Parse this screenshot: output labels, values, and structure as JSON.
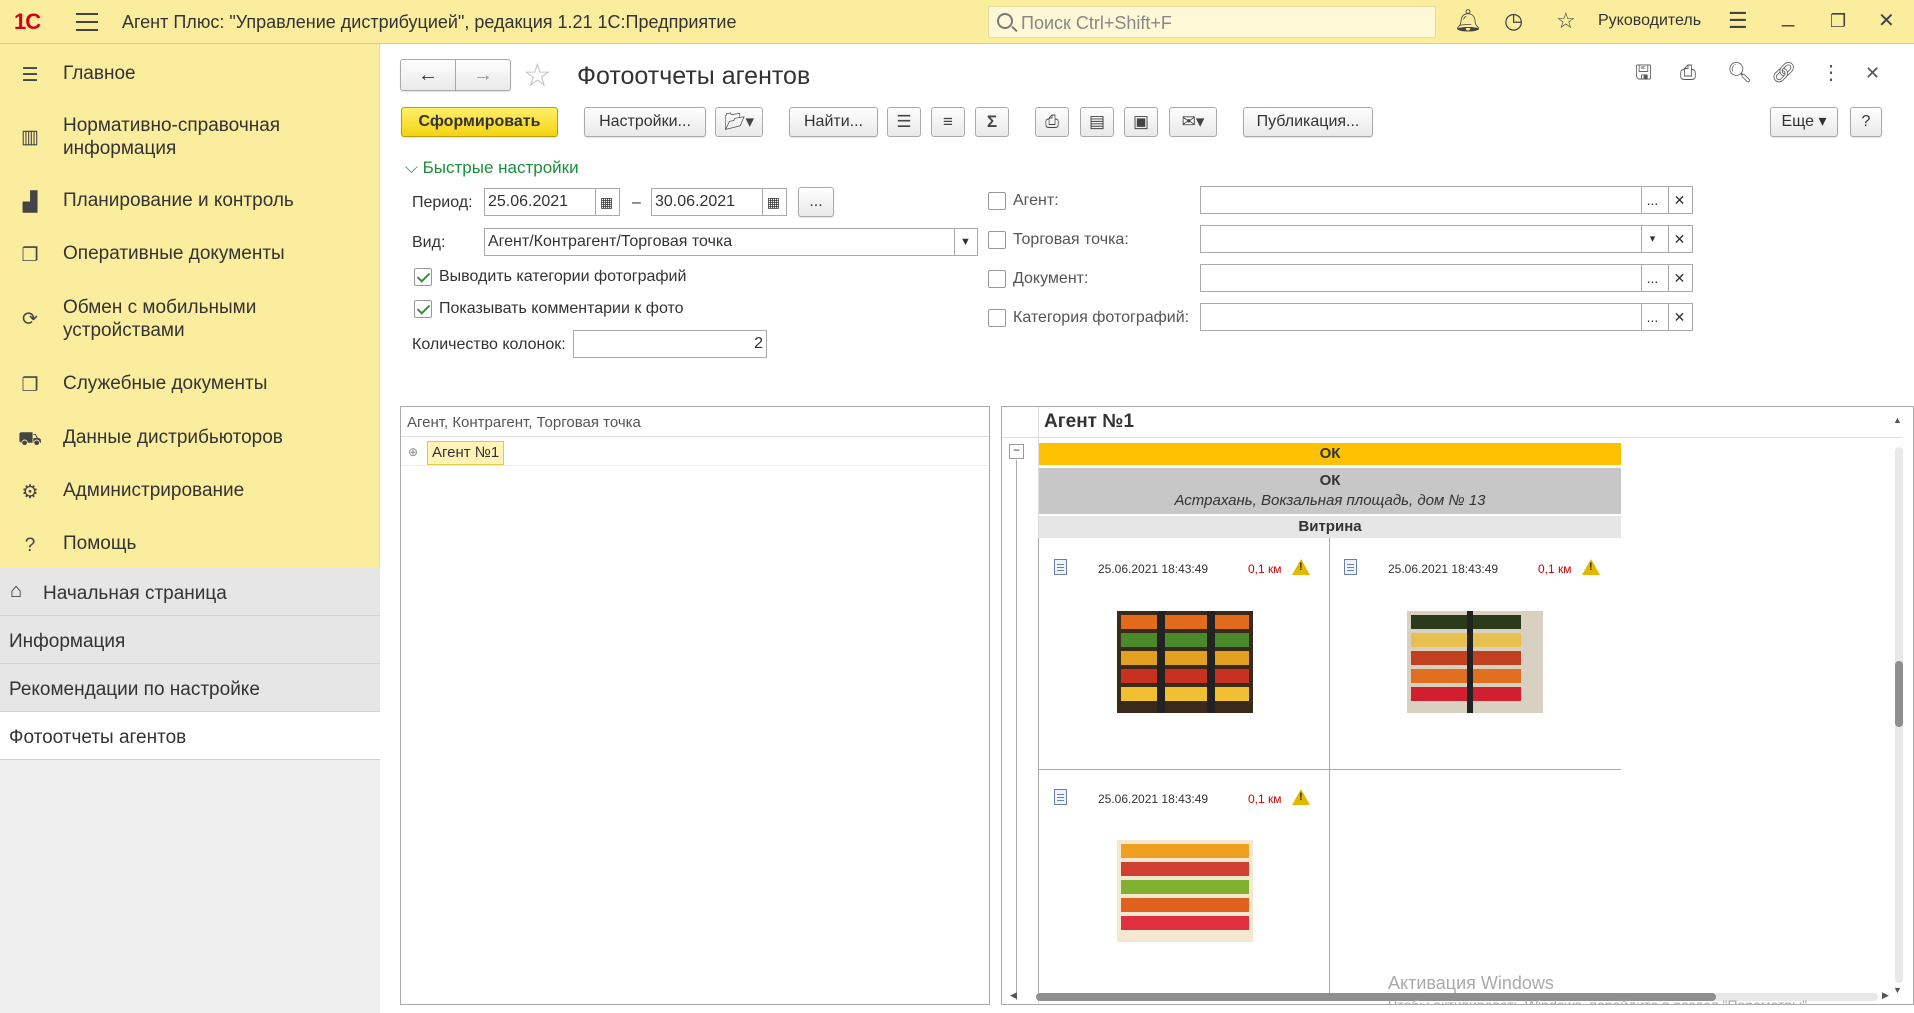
{
  "app": {
    "logo": "1С",
    "title": "Агент Плюс: \"Управление дистрибуцией\", редакция 1.21 1С:Предприятие",
    "search_placeholder": "Поиск Ctrl+Shift+F",
    "user": "Руководитель"
  },
  "sidebar": {
    "items": [
      {
        "label": "Главное",
        "icon": "menu-icon"
      },
      {
        "label": "Нормативно-справочная информация",
        "icon": "catalog-icon"
      },
      {
        "label": "Планирование и контроль",
        "icon": "chart-icon"
      },
      {
        "label": "Оперативные документы",
        "icon": "documents-icon"
      },
      {
        "label": "Обмен с мобильными устройствами",
        "icon": "sync-icon"
      },
      {
        "label": "Служебные документы",
        "icon": "service-docs-icon"
      },
      {
        "label": "Данные дистрибьюторов",
        "icon": "distributor-icon"
      },
      {
        "label": "Администрирование",
        "icon": "gear-icon"
      },
      {
        "label": "Помощь",
        "icon": "help-icon"
      }
    ],
    "open_windows": [
      {
        "label": "Начальная страница",
        "icon": "home-icon"
      },
      {
        "label": "Информация"
      },
      {
        "label": "Рекомендации по настройке"
      },
      {
        "label": "Фотоотчеты агентов"
      }
    ]
  },
  "form": {
    "title": "Фотоотчеты агентов",
    "toolbar": {
      "generate": "Сформировать",
      "settings": "Настройки...",
      "find": "Найти...",
      "publish": "Публикация...",
      "more": "Еще",
      "help": "?"
    },
    "quick_settings_label": "Быстрые настройки",
    "period_label": "Период:",
    "period_from": "25.06.2021",
    "period_dash": "–",
    "period_to": "30.06.2021",
    "period_more": "...",
    "view_label": "Вид:",
    "view_value": "Агент/Контрагент/Торговая точка",
    "show_categories": "Выводить категории фотографий",
    "show_comments": "Показывать комментарии к фото",
    "columns_label": "Количество колонок:",
    "columns_value": "2",
    "filters": [
      {
        "label": "Агент:",
        "value": "",
        "btn": "..."
      },
      {
        "label": "Торговая точка:",
        "value": "",
        "btn": "▾"
      },
      {
        "label": "Документ:",
        "value": "",
        "btn": "..."
      },
      {
        "label": "Категория фотографий:",
        "value": "",
        "btn": "..."
      }
    ]
  },
  "tree": {
    "header": "Агент, Контрагент, Торговая точка",
    "root": "Агент №1"
  },
  "report": {
    "agent": "Агент №1",
    "group1": "ОК",
    "group2": "ОК",
    "address": "Астрахань, Вокзальная площадь, дом № 13",
    "category": "Витрина",
    "photos": [
      {
        "datetime": "25.06.2021 18:43:49",
        "distance": "0,1 км"
      },
      {
        "datetime": "25.06.2021 18:43:49",
        "distance": "0,1 км"
      },
      {
        "datetime": "25.06.2021 18:43:49",
        "distance": "0,1 км"
      }
    ]
  },
  "watermark": {
    "title": "Активация Windows",
    "subtitle": "Чтобы активировать Windows, перейдите в раздел \"Параметры\"."
  }
}
